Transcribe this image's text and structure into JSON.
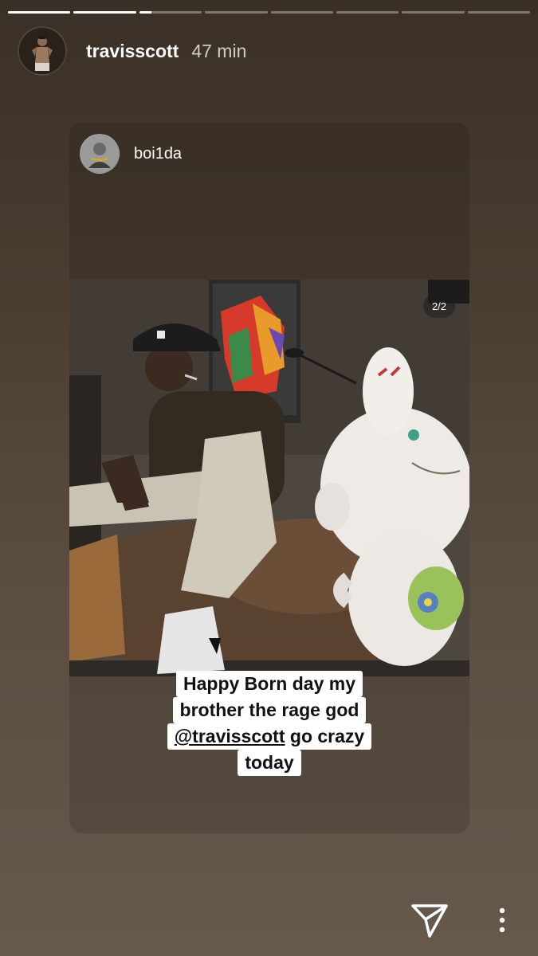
{
  "story": {
    "segments": [
      {
        "progress": 1.0
      },
      {
        "progress": 1.0
      },
      {
        "progress": 0.2
      },
      {
        "progress": 0
      },
      {
        "progress": 0
      },
      {
        "progress": 0
      },
      {
        "progress": 0
      },
      {
        "progress": 0
      }
    ],
    "username": "travisscott",
    "timestamp": "47 min"
  },
  "shared_post": {
    "username": "boi1da",
    "page_indicator": "2/2",
    "caption_lines": [
      "Happy Born day my",
      "brother the rage god"
    ],
    "mention": "@travisscott",
    "caption_line3_rest": " go crazy",
    "caption_line4": "today"
  },
  "icons": {
    "share": "paper-plane-icon",
    "more": "vertical-ellipsis-icon"
  }
}
